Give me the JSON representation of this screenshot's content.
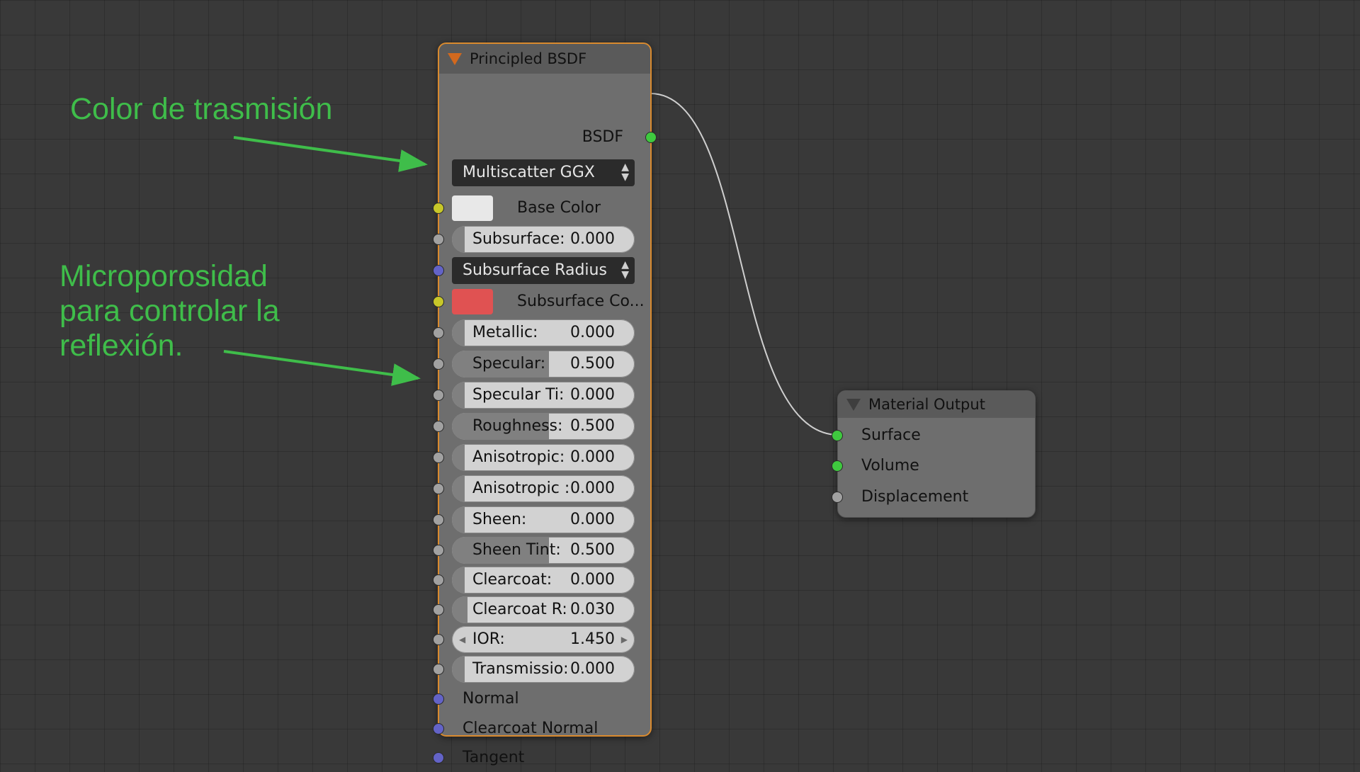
{
  "annotations": {
    "transmission": "Color de trasmisión",
    "microporosity": "Microporosidad\npara controlar la\nreflexión."
  },
  "bsdf_node": {
    "title": "Principled BSDF",
    "output_label": "BSDF",
    "distribution": "Multiscatter GGX",
    "base_color": {
      "label": "Base Color",
      "color": "#e8e8e8"
    },
    "subsurface": {
      "label": "Subsurface:",
      "value": "0.000",
      "fraction": 0.0
    },
    "subsurface_method": "Subsurface Radius",
    "subsurface_color": {
      "label": "Subsurface Co...",
      "color": "#e05252"
    },
    "metallic": {
      "label": "Metallic:",
      "value": "0.000",
      "fraction": 0.0
    },
    "specular": {
      "label": "Specular:",
      "value": "0.500",
      "fraction": 0.5
    },
    "specular_tint": {
      "label": "Specular Ti:",
      "value": "0.000",
      "fraction": 0.0
    },
    "roughness": {
      "label": "Roughness:",
      "value": "0.500",
      "fraction": 0.5
    },
    "anisotropic": {
      "label": "Anisotropic:",
      "value": "0.000",
      "fraction": 0.0
    },
    "anisotropic_rotation": {
      "label": "Anisotropic :",
      "value": "0.000",
      "fraction": 0.0
    },
    "sheen": {
      "label": "Sheen:",
      "value": "0.000",
      "fraction": 0.0
    },
    "sheen_tint": {
      "label": "Sheen Tint:",
      "value": "0.500",
      "fraction": 0.5
    },
    "clearcoat": {
      "label": "Clearcoat:",
      "value": "0.000",
      "fraction": 0.0
    },
    "clearcoat_roughness": {
      "label": "Clearcoat R:",
      "value": "0.030",
      "fraction": 0.03
    },
    "ior": {
      "label": "IOR:",
      "value": "1.450"
    },
    "transmission": {
      "label": "Transmissio:",
      "value": "0.000",
      "fraction": 0.0
    },
    "normal": "Normal",
    "clearcoat_normal": "Clearcoat Normal",
    "tangent": "Tangent"
  },
  "output_node": {
    "title": "Material Output",
    "surface": "Surface",
    "volume": "Volume",
    "displacement": "Displacement"
  },
  "colors": {
    "annotation": "#3fbd4a",
    "node_border_selected": "#d98a2e",
    "socket_color": "#c7c729",
    "socket_float": "#a1a1a1",
    "socket_vector": "#6363c7",
    "socket_shader": "#3fc93f"
  }
}
